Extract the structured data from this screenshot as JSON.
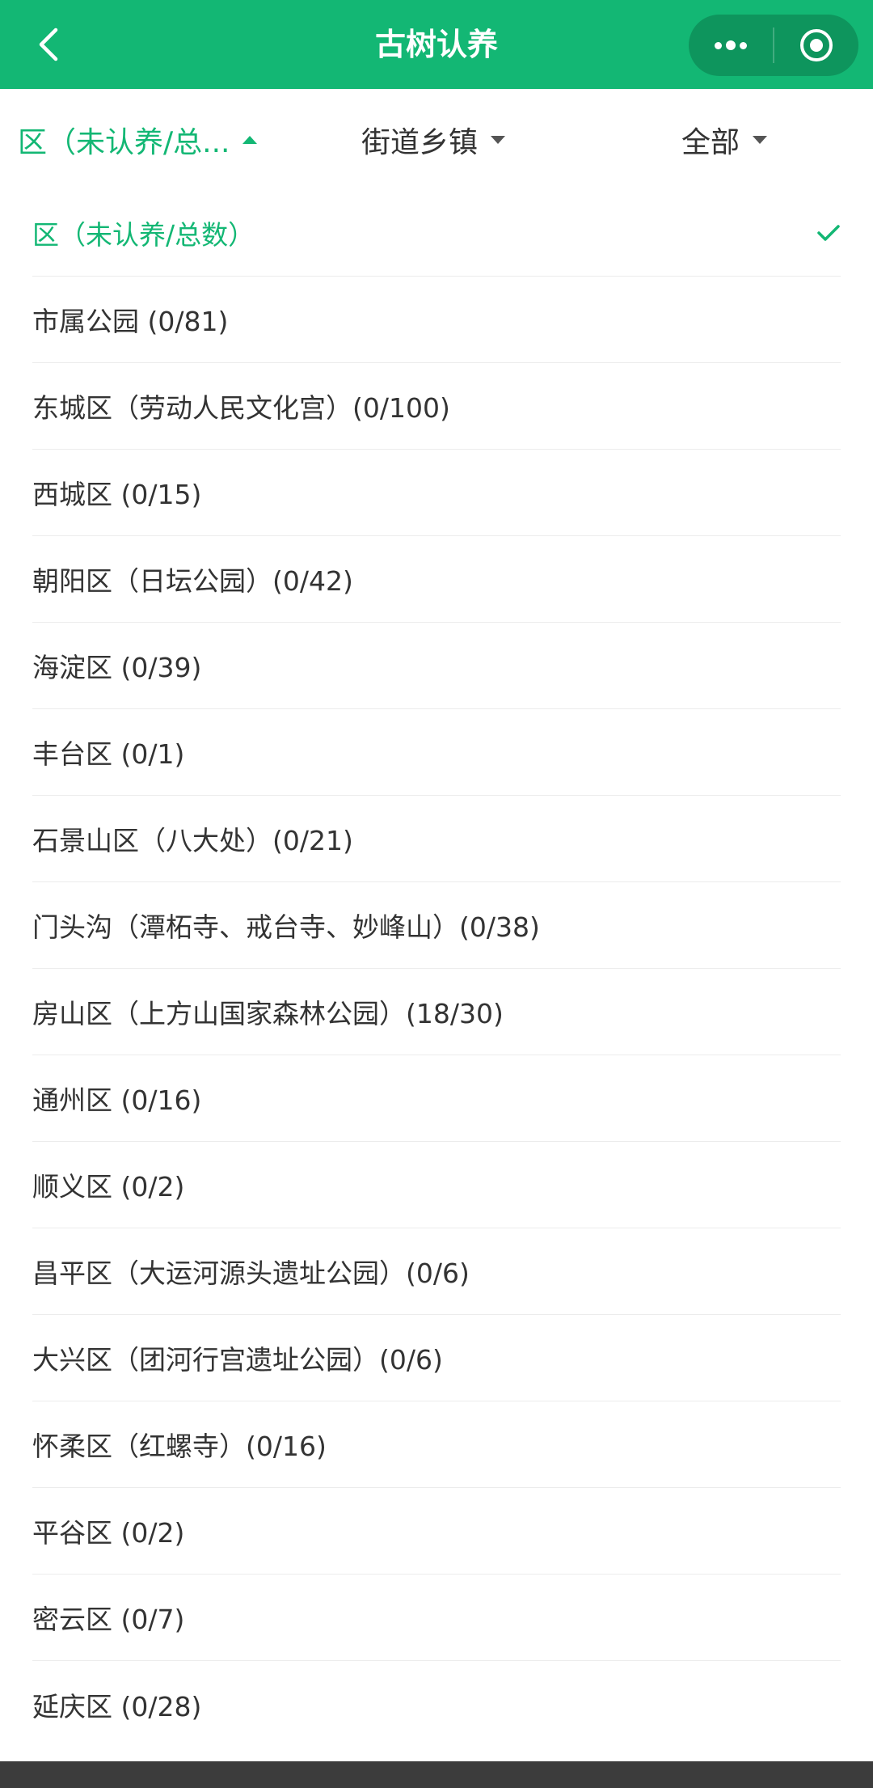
{
  "header": {
    "title": "古树认养",
    "background_color": "#13b774",
    "back_icon": "chevron-left-icon",
    "more_icon": "more-dots-icon",
    "close_icon": "target-close-icon"
  },
  "filters": [
    {
      "label": "区（未认养/总...",
      "active": true,
      "caret": "up"
    },
    {
      "label": "街道乡镇",
      "active": false,
      "caret": "down"
    },
    {
      "label": "全部",
      "active": false,
      "caret": "down"
    }
  ],
  "accent_color": "#13b774",
  "list": {
    "items": [
      {
        "label": "区（未认养/总数）",
        "selected": true
      },
      {
        "label": "市属公园 (0/81)"
      },
      {
        "label": "东城区（劳动人民文化宫）(0/100)"
      },
      {
        "label": "西城区 (0/15)"
      },
      {
        "label": "朝阳区（日坛公园）(0/42)"
      },
      {
        "label": "海淀区 (0/39)"
      },
      {
        "label": "丰台区 (0/1)"
      },
      {
        "label": "石景山区（八大处）(0/21)"
      },
      {
        "label": "门头沟（潭柘寺、戒台寺、妙峰山）(0/38)"
      },
      {
        "label": "房山区（上方山国家森林公园）(18/30)"
      },
      {
        "label": "通州区 (0/16)"
      },
      {
        "label": "顺义区 (0/2)"
      },
      {
        "label": "昌平区（大运河源头遗址公园）(0/6)"
      },
      {
        "label": "大兴区（团河行宫遗址公园）(0/6)"
      },
      {
        "label": "怀柔区（红螺寺）(0/16)"
      },
      {
        "label": "平谷区 (0/2)"
      },
      {
        "label": "密云区 (0/7)"
      },
      {
        "label": "延庆区 (0/28)"
      }
    ]
  }
}
